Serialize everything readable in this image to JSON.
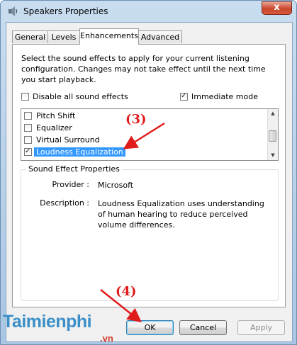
{
  "window": {
    "title": "Speakers Properties",
    "close_glyph": "x"
  },
  "tabs": [
    {
      "label": "General"
    },
    {
      "label": "Levels"
    },
    {
      "label": "Enhancements"
    },
    {
      "label": "Advanced"
    }
  ],
  "enhancements": {
    "description": "Select the sound effects to apply for your current listening configuration. Changes may not take effect until the next time you start playback.",
    "disable_all": {
      "label": "Disable all sound effects",
      "checked": false
    },
    "immediate_mode": {
      "label": "Immediate mode",
      "checked": true
    },
    "effects": [
      {
        "label": "Pitch Shift",
        "checked": false,
        "selected": false
      },
      {
        "label": "Equalizer",
        "checked": false,
        "selected": false
      },
      {
        "label": "Virtual Surround",
        "checked": false,
        "selected": false
      },
      {
        "label": "Loudness Equalization",
        "checked": true,
        "selected": true
      }
    ],
    "properties": {
      "group_title": "Sound Effect Properties",
      "provider_label": "Provider :",
      "provider_value": "Microsoft",
      "description_label": "Description :",
      "description_value": "Loudness Equalization uses understanding of human hearing to reduce perceived volume differences."
    }
  },
  "buttons": {
    "ok": "OK",
    "cancel": "Cancel",
    "apply": "Apply"
  },
  "annotations": {
    "step3": "(3)",
    "step4": "(4)",
    "color": "#e01b1b"
  },
  "watermark": {
    "brand": "Taimienphi",
    "suffix": ".vn"
  },
  "icons": {
    "app": "speaker-icon",
    "close": "close-icon",
    "scroll_up": "chevron-up-icon",
    "scroll_down": "chevron-down-icon"
  }
}
